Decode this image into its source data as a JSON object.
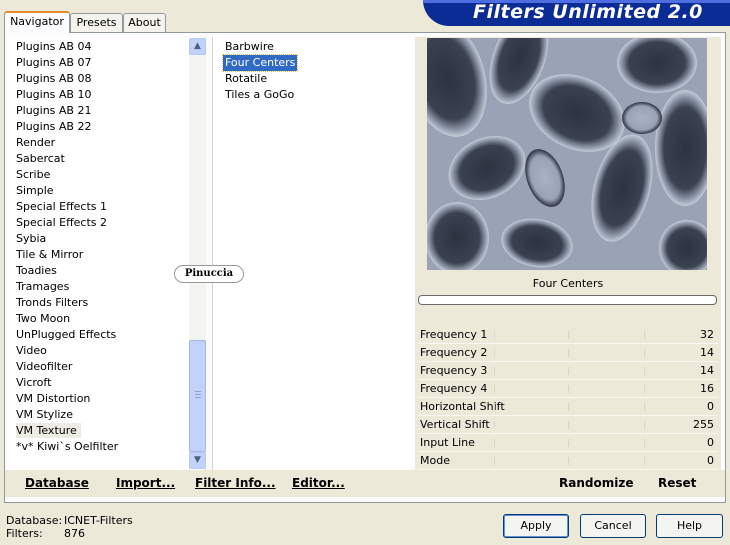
{
  "tabs": [
    "Navigator",
    "Presets",
    "About"
  ],
  "title": "Filters Unlimited 2.0",
  "categories": {
    "items": [
      "Plugins AB 04",
      "Plugins AB 07",
      "Plugins AB 08",
      "Plugins AB 10",
      "Plugins AB 21",
      "Plugins AB 22",
      "Render",
      "Sabercat",
      "Scribe",
      "Simple",
      "Special Effects 1",
      "Special Effects 2",
      "Sybia",
      "Tile & Mirror",
      "Toadies",
      "Tramages",
      "Tronds Filters",
      "Two Moon",
      "UnPlugged Effects",
      "Video",
      "Videofilter",
      "Vicroft",
      "VM Distortion",
      "VM Stylize",
      "VM Texture",
      "*v* Kiwi`s Oelfilter"
    ],
    "selected": "VM Texture",
    "scroll_position": 0.95
  },
  "filters": {
    "items": [
      "Barbwire",
      "Four Centers",
      "Rotatile",
      "Tiles a GoGo"
    ],
    "selected": "Four Centers"
  },
  "watermark": "Pinuccia",
  "preview": {
    "filter_name": "Four Centers",
    "progress": 0
  },
  "params": [
    {
      "label": "Frequency 1",
      "value": "32"
    },
    {
      "label": "Frequency 2",
      "value": "14"
    },
    {
      "label": "Frequency 3",
      "value": "14"
    },
    {
      "label": "Frequency 4",
      "value": "16"
    },
    {
      "label": "Horizontal Shift",
      "value": "0"
    },
    {
      "label": "Vertical Shift",
      "value": "255"
    },
    {
      "label": "Input Line",
      "value": "0"
    },
    {
      "label": "Mode",
      "value": "0"
    }
  ],
  "toolbar": {
    "database": "Database",
    "import": "Import...",
    "filter_info": "Filter Info...",
    "editor": "Editor...",
    "randomize": "Randomize",
    "reset": "Reset"
  },
  "status": {
    "database_label": "Database:",
    "database_value": "ICNET-Filters",
    "filters_label": "Filters:",
    "filters_value": "876"
  },
  "buttons": {
    "apply": "Apply",
    "cancel": "Cancel",
    "help": "Help"
  },
  "colors": {
    "banner": "#0b2b95",
    "selection": "#316ac5",
    "preview_dark": "#2e3440",
    "preview_light": "#a7b0c4"
  }
}
